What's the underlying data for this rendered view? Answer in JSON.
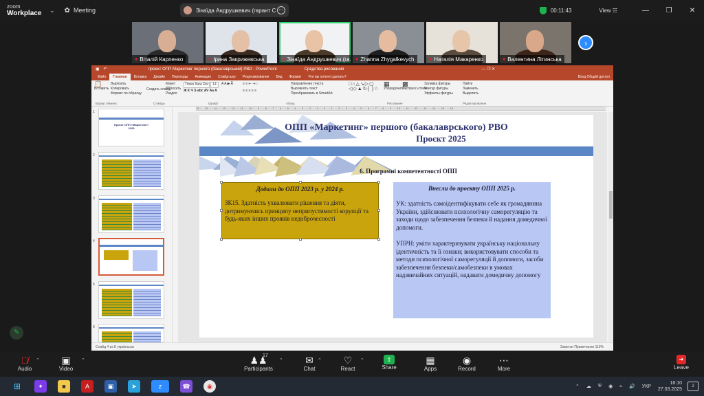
{
  "app": {
    "logo_line1": "zoom",
    "logo_line2": "Workplace",
    "meeting_label": "Meeting",
    "sharing_name": "Зінаїда Андрушкевич (гарант С",
    "timer": "00:11:43",
    "view_label": "View"
  },
  "participants": [
    {
      "name": "Віталій Карпенко",
      "skin": "#d8ae95",
      "top": "#2a2a2a"
    },
    {
      "name": "Ірина Закрижевська",
      "skin": "#e3c0a6",
      "top": "#3a2b22"
    },
    {
      "name": "Зінаїда Андрушкевич (га...",
      "skin": "#e9c3a6",
      "top": "#4a3a2a"
    },
    {
      "name": "Zhanna Zhygalkevych",
      "skin": "#e5bca0",
      "top": "#1e1e1e"
    },
    {
      "name": "Наталія Макаренко",
      "skin": "#e7c5a9",
      "top": "#5b4b3e"
    },
    {
      "name": "Валентина Літинська",
      "skin": "#d9a88a",
      "top": "#3b2418"
    }
  ],
  "ppt": {
    "window_title": "проект ОПП Маркетинг першого (бакалаврський) РВО - PowerPoint",
    "context_tab": "Средства рисования",
    "tabs": [
      "Файл",
      "Главная",
      "Вставка",
      "Дизайн",
      "Переходы",
      "Анимация",
      "Слайд-шоу",
      "Рецензирование",
      "Вид",
      "Формат",
      "Что вы хотите сделать?"
    ],
    "tabs_right": "Вход  Общий доступ",
    "ribbon_groups": {
      "clipboard": [
        "Вставить",
        "Вырезать",
        "Копировать",
        "Формат по образцу"
      ],
      "slides": [
        "Макет",
        "Сбросить",
        "Раздел",
        "Создать слайд"
      ],
      "font": "Times New Ror",
      "font_size": "14",
      "paragraph": [
        "Направление текста",
        "Выровнять текст",
        "Преобразовать в SmartArt"
      ],
      "drawing": [
        "Упорядочить",
        "Экспресс-стили",
        "Заливка фигуры",
        "Контур фигуры",
        "Эффекты фигуры"
      ],
      "editing": [
        "Найти",
        "Заменить",
        "Выделить"
      ]
    },
    "group_labels": [
      "Буфер обмена",
      "Слайды",
      "Шрифт",
      "Абзац",
      "Рисование",
      "Редактирование"
    ],
    "thumb_numbers": [
      "1",
      "2",
      "3",
      "4",
      "5",
      "6"
    ],
    "thumb1_title": "Проект ОПП «Маркетинг» 2025",
    "status_left": "Слайд 4 из 8   українська",
    "status_right": "Заметки   Примечания   119%"
  },
  "slide": {
    "title": "ОПП «Маркетинг» першого (бакалаврського) РВО",
    "subtitle": "Проєкт 2025",
    "section": "6. Програмні компетентності ОПП",
    "box1_heading": "Додали до ОПП 2023 р. у 2024 р.",
    "box1_text": "ЗК15. Здатність ухвалювати рішення та діяти, дотримуючись принципу неприпустимості корупції та будь-яких інших проявів недоброчесності",
    "box2_heading": "Внесли до проєкту ОПП 2025 р.",
    "box2_p1": "УК: здатність самоідентифікувати себе як громадянина України, здійснювати психологічну саморегуляцію та заходи щодо забезпечення безпеки й надання домедичної допомоги.",
    "box2_p2": "УПРН: уміти характеризувати українську національну ідентичність та її ознаки; використовувати способи та методи психологічної саморегуляції й допомоги, засоби забезпечення безпеки/самобезпеки в умовах надзвичайних ситуацій, надавати домедичну допомогу"
  },
  "toolbar": {
    "audio": "Audio",
    "video": "Video",
    "participants": "Participants",
    "participants_count": "17",
    "chat": "Chat",
    "react": "React",
    "share": "Share",
    "apps": "Apps",
    "record": "Record",
    "more": "More",
    "leave": "Leave"
  },
  "taskbar": {
    "lang": "УКР",
    "time": "16:10",
    "date": "27.03.2025",
    "notif_count": "2"
  },
  "colors": {
    "accent_green": "#1fb14f",
    "zoom_blue": "#2d8cff",
    "ppt_red": "#b7472a",
    "slide_title": "#2e3470",
    "box_gold": "#c9a40c",
    "box_lavender": "#b9c7f5",
    "band_blue": "#5a86c5"
  }
}
